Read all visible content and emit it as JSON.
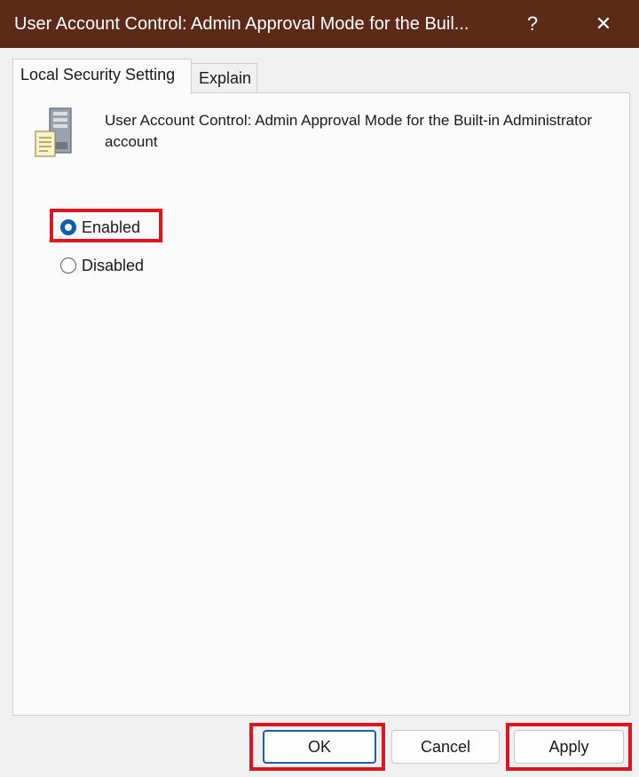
{
  "window": {
    "title": "User Account Control: Admin Approval Mode for the Buil...",
    "help_glyph": "?",
    "close_glyph": "✕"
  },
  "tabs": [
    {
      "label": "Local Security Setting",
      "active": true
    },
    {
      "label": "Explain",
      "active": false
    }
  ],
  "policy": {
    "icon": "server-policy-icon",
    "description": "User Account Control: Admin Approval Mode for the Built-in Administrator account"
  },
  "options": [
    {
      "label": "Enabled",
      "selected": true
    },
    {
      "label": "Disabled",
      "selected": false
    }
  ],
  "buttons": {
    "ok": "OK",
    "cancel": "Cancel",
    "apply": "Apply"
  },
  "colors": {
    "titlebar": "#5c2b18",
    "highlight": "#e0141f",
    "radio_accent": "#0a5fb4"
  }
}
